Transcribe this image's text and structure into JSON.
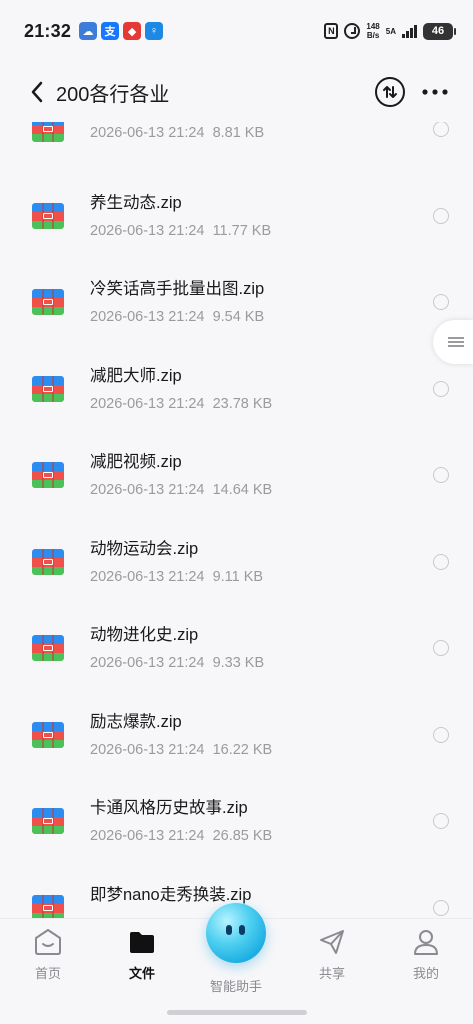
{
  "status_bar": {
    "time": "21:32",
    "apps": [
      {
        "name": "weather",
        "color": "#3b7dd8",
        "glyph": "☁"
      },
      {
        "name": "alipay",
        "color": "#1677ff",
        "glyph": "支"
      },
      {
        "name": "app-red",
        "color": "#e53935",
        "glyph": "◆"
      },
      {
        "name": "app-blue",
        "color": "#1e88e5",
        "glyph": "♀"
      }
    ],
    "nfc_label": "N",
    "net_speed_value": "148",
    "net_speed_unit": "B/s",
    "signal_label": "5A",
    "battery": "46"
  },
  "header": {
    "title": "200各行各业"
  },
  "files": [
    {
      "name": "",
      "date": "2026-06-13 21:24",
      "size": "8.81 KB"
    },
    {
      "name": "养生动态.zip",
      "date": "2026-06-13 21:24",
      "size": "11.77 KB"
    },
    {
      "name": "冷笑话高手批量出图.zip",
      "date": "2026-06-13 21:24",
      "size": "9.54 KB"
    },
    {
      "name": "减肥大师.zip",
      "date": "2026-06-13 21:24",
      "size": "23.78 KB"
    },
    {
      "name": "减肥视频.zip",
      "date": "2026-06-13 21:24",
      "size": "14.64 KB"
    },
    {
      "name": "动物运动会.zip",
      "date": "2026-06-13 21:24",
      "size": "9.11 KB"
    },
    {
      "name": "动物进化史.zip",
      "date": "2026-06-13 21:24",
      "size": "9.33 KB"
    },
    {
      "name": "励志爆款.zip",
      "date": "2026-06-13 21:24",
      "size": "16.22 KB"
    },
    {
      "name": "卡通风格历史故事.zip",
      "date": "2026-06-13 21:24",
      "size": "26.85 KB"
    },
    {
      "name": "即梦nano走秀换装.zip",
      "date": "",
      "size": ""
    }
  ],
  "bottom_nav": {
    "home": "首页",
    "files": "文件",
    "assistant": "智能助手",
    "share": "共享",
    "mine": "我的"
  },
  "colors": {
    "accent": "#111111",
    "muted": "#9a9a9f",
    "zip_blue": "#2d8cf0",
    "zip_red": "#f0504a",
    "zip_green": "#4cc15a"
  }
}
